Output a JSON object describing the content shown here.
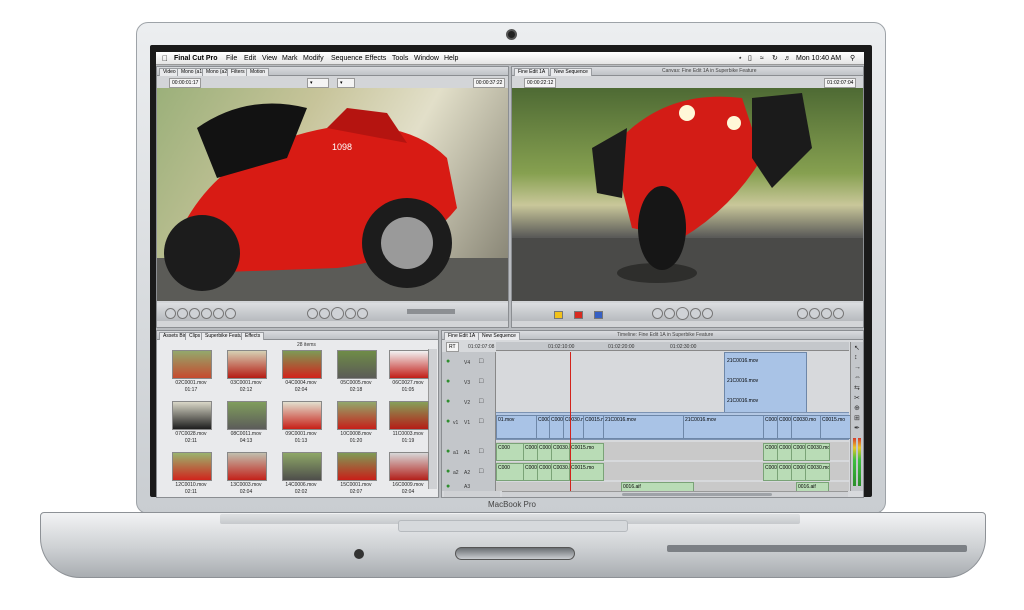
{
  "device": {
    "label": "MacBook Pro"
  },
  "menubar": {
    "app": "Final Cut Pro",
    "items": [
      "File",
      "Edit",
      "View",
      "Mark",
      "Modify",
      "Sequence",
      "Effects",
      "Tools",
      "Window",
      "Help"
    ],
    "clock": "Mon 10:40 AM"
  },
  "viewer": {
    "tabs": [
      "Video",
      "Mono (a1)",
      "Mono (a2)",
      "Filters",
      "Motion"
    ],
    "tc_left": "00:00:01:17",
    "tc_right": "00:00:37:22"
  },
  "canvas": {
    "title": "Canvas: Fine Edit 1A in Superbike Feature",
    "tabs": [
      "Fine Edit 1A",
      "New Sequence"
    ],
    "tc_left": "00:00:22:12",
    "tc_right": "01:02:07:04"
  },
  "browser": {
    "tabs": [
      "Assets Bin",
      "Clips",
      "Superbike Feature",
      "Effects"
    ],
    "count": "28 items",
    "clips": [
      {
        "name": "02C0001.mov",
        "dur": "01:17"
      },
      {
        "name": "03C0001.mov",
        "dur": "02:12"
      },
      {
        "name": "04C0004.mov",
        "dur": "02:04"
      },
      {
        "name": "05C0005.mov",
        "dur": "02:18"
      },
      {
        "name": "06C0027.mov",
        "dur": "01:05"
      },
      {
        "name": "07C0028.mov",
        "dur": "02:11"
      },
      {
        "name": "08C0011.mov",
        "dur": "04:13"
      },
      {
        "name": "09C0001.mov",
        "dur": "01:13"
      },
      {
        "name": "10C0008.mov",
        "dur": "01:20"
      },
      {
        "name": "11C0003.mov",
        "dur": "01:19"
      },
      {
        "name": "12C0010.mov",
        "dur": "02:11"
      },
      {
        "name": "13C0003.mov",
        "dur": "02:04"
      },
      {
        "name": "14C0006.mov",
        "dur": "02:02"
      },
      {
        "name": "15C0001.mov",
        "dur": "02:07"
      },
      {
        "name": "16C0009.mov",
        "dur": "02:04"
      }
    ]
  },
  "timeline": {
    "title": "Timeline: Fine Edit 1A in Superbike Feature",
    "tabs": [
      "Fine Edit 1A",
      "New Sequence"
    ],
    "rt": "RT",
    "tc": "01:02:07:08",
    "ruler": [
      "01:02:10:00",
      "01:02:20:00",
      "01:02:30:00"
    ],
    "tracks": [
      "V4",
      "V3",
      "V2",
      "V1",
      "A1",
      "A2",
      "A3"
    ],
    "source_v": "v1",
    "source_a1": "a1",
    "source_a2": "a2",
    "v2_clip": "21C0016.mov",
    "v3_clip": "21C0016.mov",
    "v4_clip": "21C0016.mov",
    "v1_clips": [
      "01.mov",
      "C000",
      "C000",
      "C0030.mo",
      "C0015.mo",
      "21C0016.mov",
      "21C0016.mov",
      "C000",
      "C000",
      "C0030.mo",
      "C0015.mo"
    ],
    "a1_clips": [
      "C000",
      "C000",
      "C0008",
      "C0030.mo",
      "C0015.mo",
      "C000",
      "C000",
      "C0008",
      "C0030.mo"
    ],
    "a2_clips": [
      "C000",
      "C000",
      "C0008",
      "C0030.mo",
      "C0015.mo",
      "C000",
      "C000",
      "C0008",
      "C0030.mo"
    ],
    "a3_labels": [
      "0016.aif",
      "0016.aif"
    ]
  }
}
